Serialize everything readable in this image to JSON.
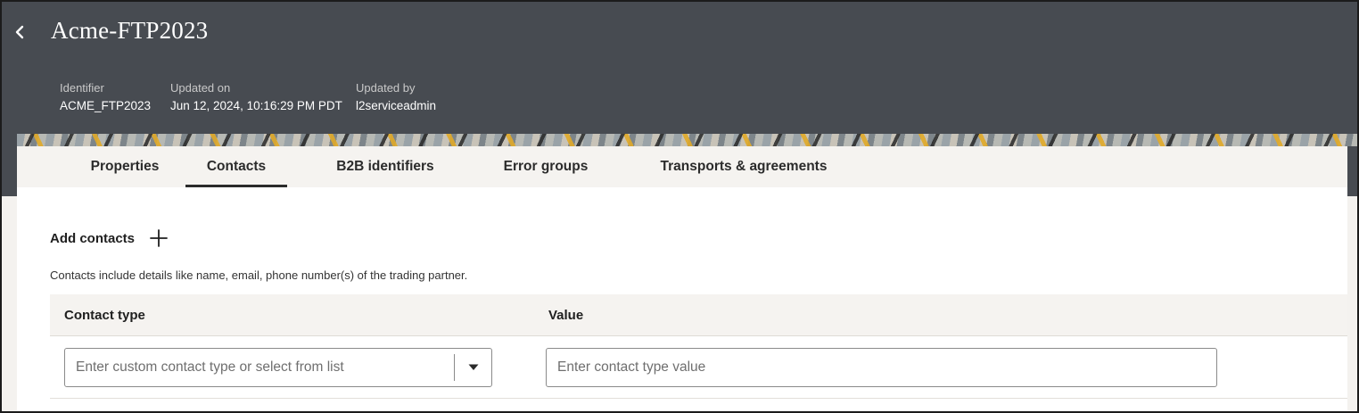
{
  "header": {
    "title": "Acme-FTP2023",
    "meta": [
      {
        "label": "Identifier",
        "value": "ACME_FTP2023"
      },
      {
        "label": "Updated on",
        "value": "Jun 12, 2024, 10:16:29 PM PDT"
      },
      {
        "label": "Updated by",
        "value": "l2serviceadmin"
      }
    ]
  },
  "tabs": [
    {
      "label": "Properties",
      "active": false
    },
    {
      "label": "Contacts",
      "active": true
    },
    {
      "label": "B2B identifiers",
      "active": false
    },
    {
      "label": "Error groups",
      "active": false
    },
    {
      "label": "Transports & agreements",
      "active": false
    }
  ],
  "contacts": {
    "add_label": "Add contacts",
    "helper_text": "Contacts include details like name, email, phone number(s) of the trading partner.",
    "columns": [
      "Contact type",
      "Value"
    ],
    "row": {
      "contact_type_placeholder": "Enter custom contact type or select from list",
      "value_placeholder": "Enter contact type value"
    }
  },
  "icons": {
    "back": "chevron-left-icon",
    "add": "plus-icon",
    "dropdown": "caret-down-icon"
  },
  "colors": {
    "header_bg": "#474b51",
    "tabbar_bg": "#f5f3f0",
    "accent_underline": "#2b2b2b"
  }
}
